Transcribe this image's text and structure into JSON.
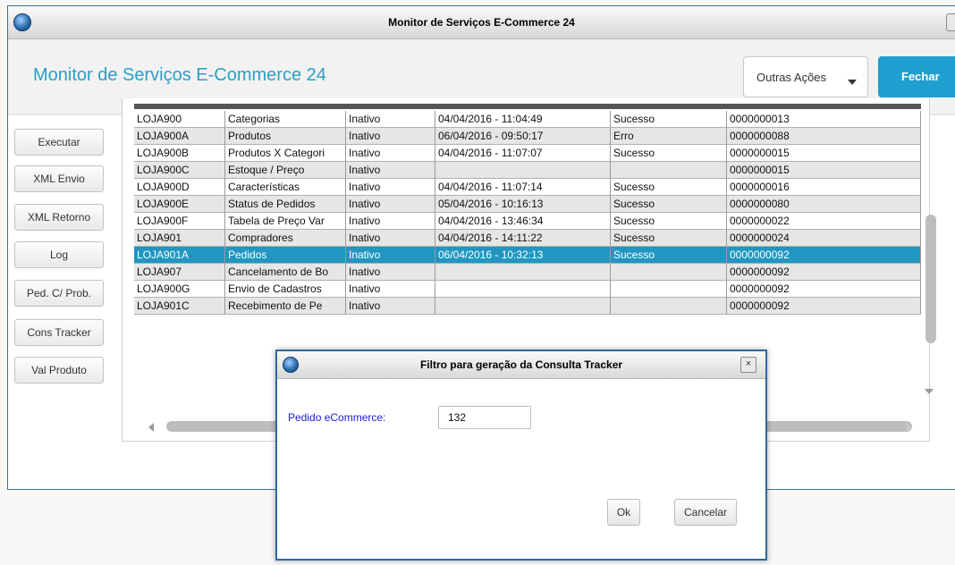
{
  "window": {
    "title": "Monitor de Serviços E-Commerce 24"
  },
  "header": {
    "title": "Monitor de Serviços E-Commerce 24",
    "more_actions_label": "Outras Ações",
    "close_label": "Fechar"
  },
  "sidebar": {
    "buttons": [
      {
        "label": "Executar"
      },
      {
        "label": "XML Envio"
      },
      {
        "label": "XML Retorno"
      },
      {
        "label": "Log"
      },
      {
        "label": "Ped. C/ Prob."
      },
      {
        "label": "Cons Tracker"
      },
      {
        "label": "Val Produto"
      }
    ]
  },
  "grid": {
    "rows": [
      [
        "LOJA900",
        "Categorias",
        "Inativo",
        "04/04/2016 - 11:04:49",
        "Sucesso",
        "0000000013"
      ],
      [
        "LOJA900A",
        "Produtos",
        "Inativo",
        "06/04/2016 - 09:50:17",
        "Erro",
        "0000000088"
      ],
      [
        "LOJA900B",
        "Produtos X Categori",
        "Inativo",
        "04/04/2016 - 11:07:07",
        "Sucesso",
        "0000000015"
      ],
      [
        "LOJA900C",
        "Estoque / Preço",
        "Inativo",
        "",
        "",
        "0000000015"
      ],
      [
        "LOJA900D",
        "Características",
        "Inativo",
        "04/04/2016 - 11:07:14",
        "Sucesso",
        "0000000016"
      ],
      [
        "LOJA900E",
        "Status de Pedidos",
        "Inativo",
        "05/04/2016 - 10:16:13",
        "Sucesso",
        "0000000080"
      ],
      [
        "LOJA900F",
        "Tabela de Preço Var",
        "Inativo",
        "04/04/2016 - 13:46:34",
        "Sucesso",
        "0000000022"
      ],
      [
        "LOJA901",
        "Compradores",
        "Inativo",
        "04/04/2016 - 14:11:22",
        "Sucesso",
        "0000000024"
      ],
      [
        "LOJA901A",
        "Pedidos",
        "Inativo",
        "06/04/2016 - 10:32:13",
        "Sucesso",
        "0000000092"
      ],
      [
        "LOJA907",
        "Cancelamento de Bo",
        "Inativo",
        "",
        "",
        "0000000092"
      ],
      [
        "LOJA900G",
        "Envio de Cadastros",
        "Inativo",
        "",
        "",
        "0000000092"
      ],
      [
        "LOJA901C",
        "Recebimento de Pe",
        "Inativo",
        "",
        "",
        "0000000092"
      ]
    ],
    "selected_row": "LOJA901A"
  },
  "dialog": {
    "title": "Filtro para geração da Consulta Tracker",
    "close_glyph": "×",
    "field_label": "Pedido eCommerce:",
    "field_value": "132",
    "ok_label": "Ok",
    "cancel_label": "Cancelar"
  },
  "colors": {
    "accent": "#2c9ec4",
    "primary_button": "#1f9ed0",
    "selected_row": "#2196c1",
    "dialog_label": "#1a1ad6"
  },
  "icons": {
    "app": "totvs-globe-icon",
    "dropdown": "caret-down-icon"
  }
}
